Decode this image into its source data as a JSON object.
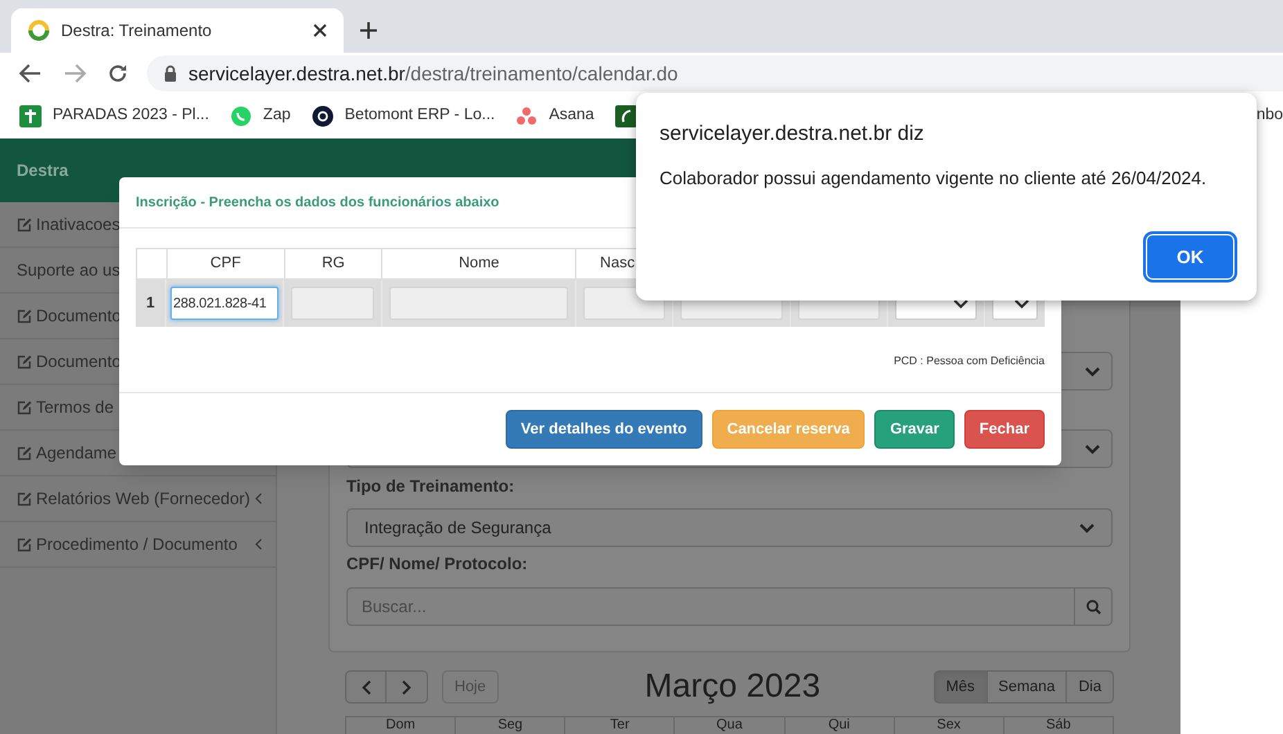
{
  "browser": {
    "tab": {
      "title": "Destra: Treinamento"
    },
    "url": {
      "host": "servicelayer.destra.net.br",
      "path": "/destra/treinamento/calendar.do"
    },
    "bookmarks": [
      {
        "label": "PARADAS 2023 - Pl...",
        "kind": "cross"
      },
      {
        "label": "Zap",
        "kind": "chat"
      },
      {
        "label": "Betomont ERP - Lo...",
        "kind": "disc"
      },
      {
        "label": "Asana",
        "kind": "dots"
      },
      {
        "kind": "square"
      },
      {
        "label": "nbo",
        "kind": "none"
      }
    ]
  },
  "app": {
    "brand": "Destra",
    "sidebar": [
      {
        "label": "Inativacoes",
        "icon": true
      },
      {
        "label": "Suporte ao us",
        "icon": false
      },
      {
        "label": "Documento",
        "icon": true
      },
      {
        "label": "Documento",
        "icon": true
      },
      {
        "label": "Termos de",
        "icon": true
      },
      {
        "label": "Agendame",
        "icon": true
      },
      {
        "label": "Relatórios Web (Fornecedor)",
        "icon": true,
        "expandable": true
      },
      {
        "label": "Procedimento / Documento",
        "icon": true,
        "expandable": true
      }
    ]
  },
  "filters": {
    "training_label": "Tipo de Treinamento:",
    "training_value": "Integração de Segurança",
    "search_label": "CPF/ Nome/ Protocolo:",
    "search_placeholder": "Buscar..."
  },
  "calendar": {
    "title": "Março 2023",
    "today": "Hoje",
    "views": [
      {
        "label": "Mês",
        "selected": true
      },
      {
        "label": "Semana",
        "selected": false
      },
      {
        "label": "Dia",
        "selected": false
      }
    ],
    "weekdays": [
      "Dom",
      "Seg",
      "Ter",
      "Qua",
      "Qui",
      "Sex",
      "Sáb"
    ]
  },
  "modal": {
    "title": "Inscrição - Preencha os dados dos funcionários abaixo",
    "columns": [
      "CPF",
      "RG",
      "Nome",
      "Nasc"
    ],
    "rows": [
      {
        "number": "1",
        "cells": [
          {
            "kind": "input",
            "value": "288.021.828-41",
            "focused": true
          },
          {
            "kind": "disabled"
          },
          {
            "kind": "disabled"
          },
          {
            "kind": "disabled"
          },
          {
            "kind": "disabled"
          },
          {
            "kind": "disabled"
          },
          {
            "kind": "select"
          },
          {
            "kind": "select"
          }
        ]
      }
    ],
    "note": "PCD : Pessoa com Deficiência",
    "buttons": [
      {
        "label": "Ver detalhes do evento",
        "kind": "primary"
      },
      {
        "label": "Cancelar reserva",
        "kind": "warning"
      },
      {
        "label": "Gravar",
        "kind": "success"
      },
      {
        "label": "Fechar",
        "kind": "danger"
      }
    ]
  },
  "alert": {
    "title": "servicelayer.destra.net.br diz",
    "message": "Colaborador possui agendamento vigente no cliente até 26/04/2024.",
    "button": "OK"
  }
}
